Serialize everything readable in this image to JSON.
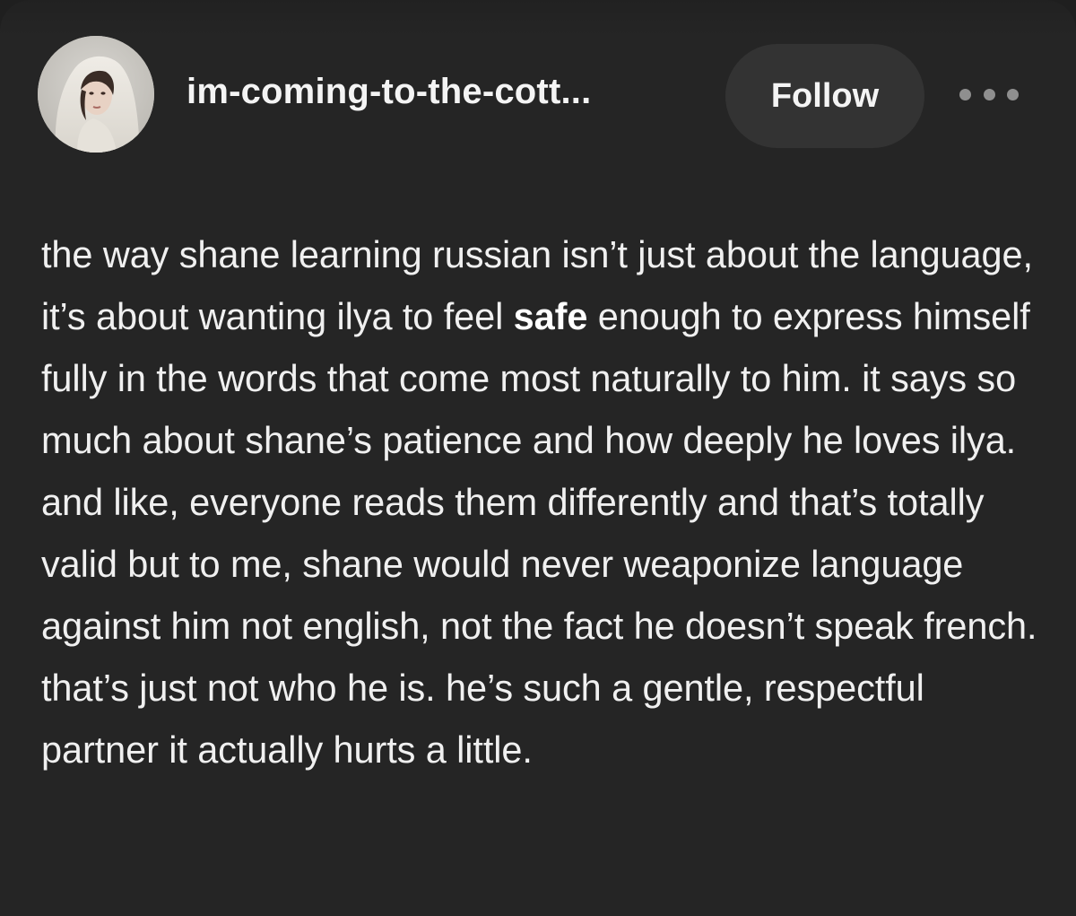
{
  "post": {
    "author": {
      "username": "im-coming-to-the-cott...",
      "avatar_icon": "avatar-photo-hooded-woman"
    },
    "follow_label": "Follow",
    "more_icon": "more-dots-icon",
    "body": {
      "text_before": "the way shane learning russian isn’t just about the language, it’s about wanting ilya to feel ",
      "bold_text": "safe",
      "text_after": " enough to express himself fully in the words that come most naturally to him. it says so much about shane’s patience and how deeply he loves ilya. and like, everyone reads them differently and that’s totally valid but to me, shane would never weaponize language against him not english, not the fact he doesn’t speak french. that’s just not who he is. he’s such a gentle, respectful partner it actually hurts a little."
    }
  },
  "colors": {
    "background": "#252525",
    "button_bg": "#333333",
    "text": "#f0f0f0",
    "muted_icon": "#8f8f8f"
  }
}
